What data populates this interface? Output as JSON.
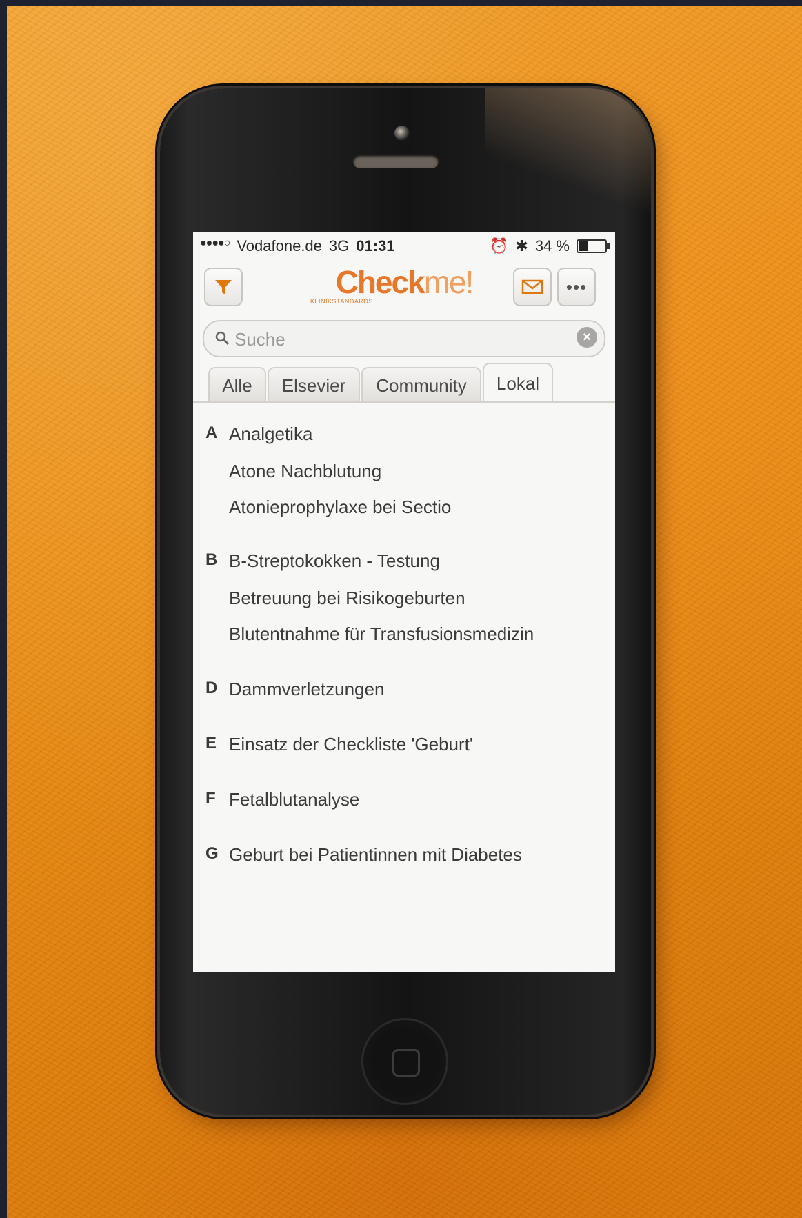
{
  "status_bar": {
    "carrier": "Vodafone.de",
    "network": "3G",
    "time": "01:31",
    "battery": "34 %"
  },
  "header": {
    "logo_bold": "Check",
    "logo_light": "me!",
    "logo_sub": "KLINIKSTANDARDS"
  },
  "search": {
    "placeholder": "Suche"
  },
  "tabs": [
    {
      "label": "Alle"
    },
    {
      "label": "Elsevier"
    },
    {
      "label": "Community"
    },
    {
      "label": "Lokal"
    }
  ],
  "sections": [
    {
      "letter": "A",
      "items": [
        "Analgetika",
        "Atone Nachblutung",
        "Atonieprophylaxe bei Sectio"
      ]
    },
    {
      "letter": "B",
      "items": [
        "B-Streptokokken - Testung",
        "Betreuung bei Risikogeburten",
        "Blutentnahme für Transfusionsmedizin"
      ]
    },
    {
      "letter": "D",
      "items": [
        "Dammverletzungen"
      ]
    },
    {
      "letter": "E",
      "items": [
        "Einsatz der Checkliste 'Geburt'"
      ]
    },
    {
      "letter": "F",
      "items": [
        "Fetalblutanalyse"
      ]
    },
    {
      "letter": "G",
      "items": [
        "Geburt bei Patientinnen mit Diabetes"
      ]
    }
  ]
}
